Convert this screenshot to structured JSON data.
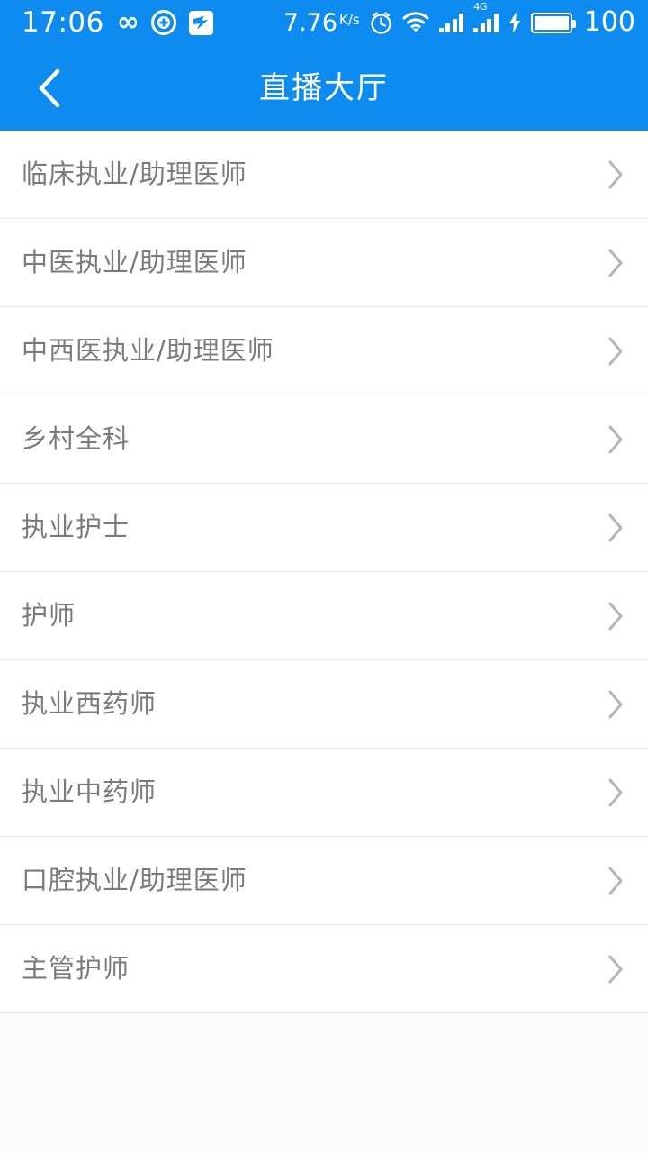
{
  "statusbar": {
    "time": "17:06",
    "infinity_glyph": "∞",
    "icons_left": [
      "infinity-icon",
      "circle-plus-icon",
      "app-square-icon"
    ],
    "network_speed": "7.76",
    "network_speed_unit": "K/s",
    "network_speed_unit_top": "K",
    "network_speed_unit_bottom": "/s",
    "icons_right": [
      "alarm-clock-icon",
      "wifi-icon",
      "signal-bars-icon",
      "signal-4g-icon",
      "charging-bolt-icon",
      "battery-icon"
    ],
    "mobile_network_label": "4G",
    "battery_percent": "100",
    "background_color": "#0d8bef",
    "foreground_color": "#ffffff"
  },
  "header": {
    "title": "直播大厅",
    "back_icon": "chevron-left-icon",
    "background_color": "#0d8bef",
    "title_color": "#ffffff"
  },
  "list": {
    "chevron_icon": "chevron-right-icon",
    "divider_color": "#e8e8e8",
    "text_color": "#7b7b7b",
    "items": [
      {
        "label": "临床执业/助理医师"
      },
      {
        "label": "中医执业/助理医师"
      },
      {
        "label": "中西医执业/助理医师"
      },
      {
        "label": "乡村全科"
      },
      {
        "label": "执业护士"
      },
      {
        "label": "护师"
      },
      {
        "label": "执业西药师"
      },
      {
        "label": "执业中药师"
      },
      {
        "label": "口腔执业/助理医师"
      },
      {
        "label": "主管护师"
      }
    ]
  }
}
